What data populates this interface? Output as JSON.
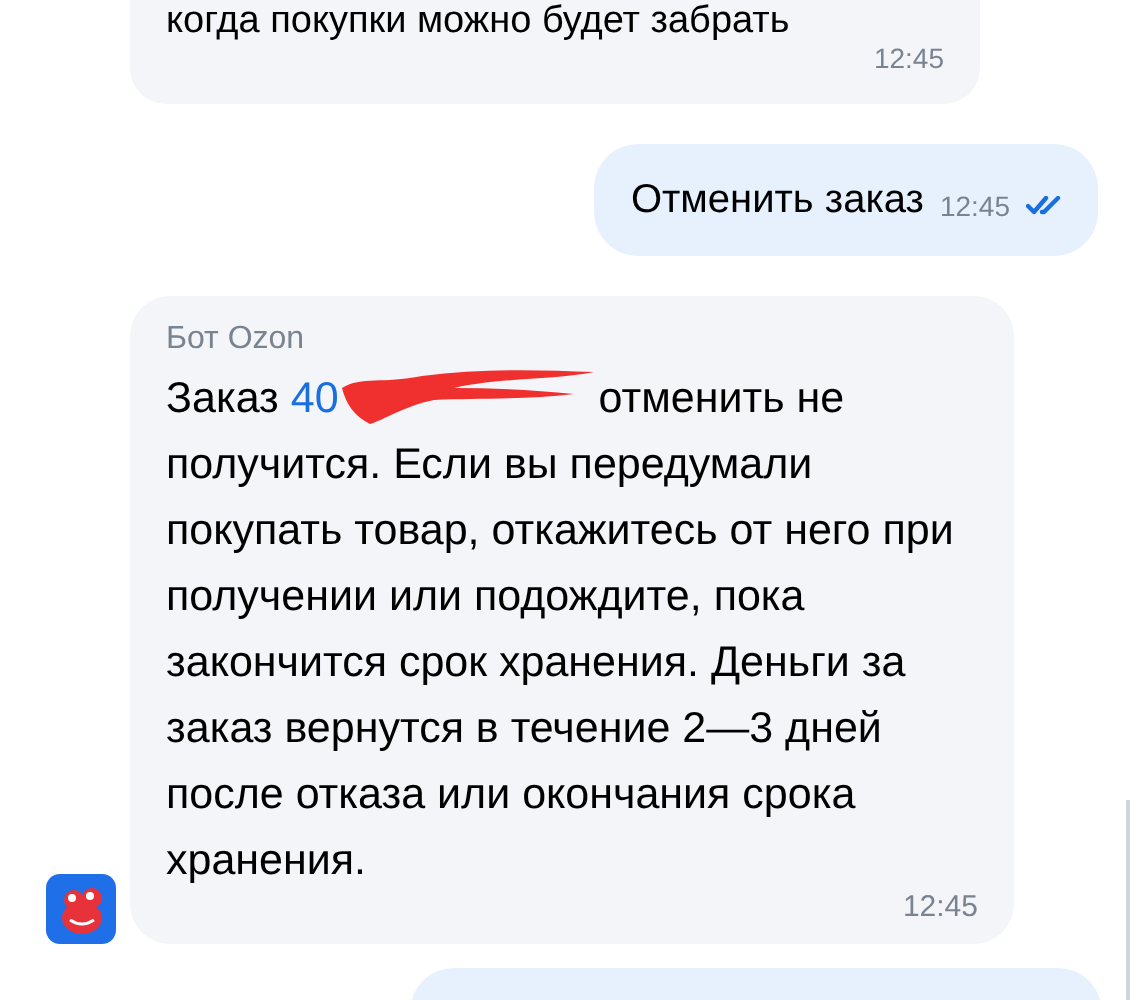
{
  "messages": [
    {
      "kind": "incoming",
      "text": "когда покупки можно будет забрать",
      "time": "12:45"
    },
    {
      "kind": "outgoing",
      "text": "Отменить заказ",
      "time": "12:45",
      "read": true
    },
    {
      "kind": "bot",
      "sender": "Бот Ozon",
      "text_start": "Заказ",
      "order_link": "40",
      "text": "отменить не получится. Если вы передумали покупать товар, откажитесь от него при получении или подождите, пока закончится срок хранения. Деньги за заказ вернутся в течение 2—3 дней после отказа или окончания срока хранения.",
      "time": "12:45"
    },
    {
      "kind": "outgoing_partial"
    }
  ]
}
